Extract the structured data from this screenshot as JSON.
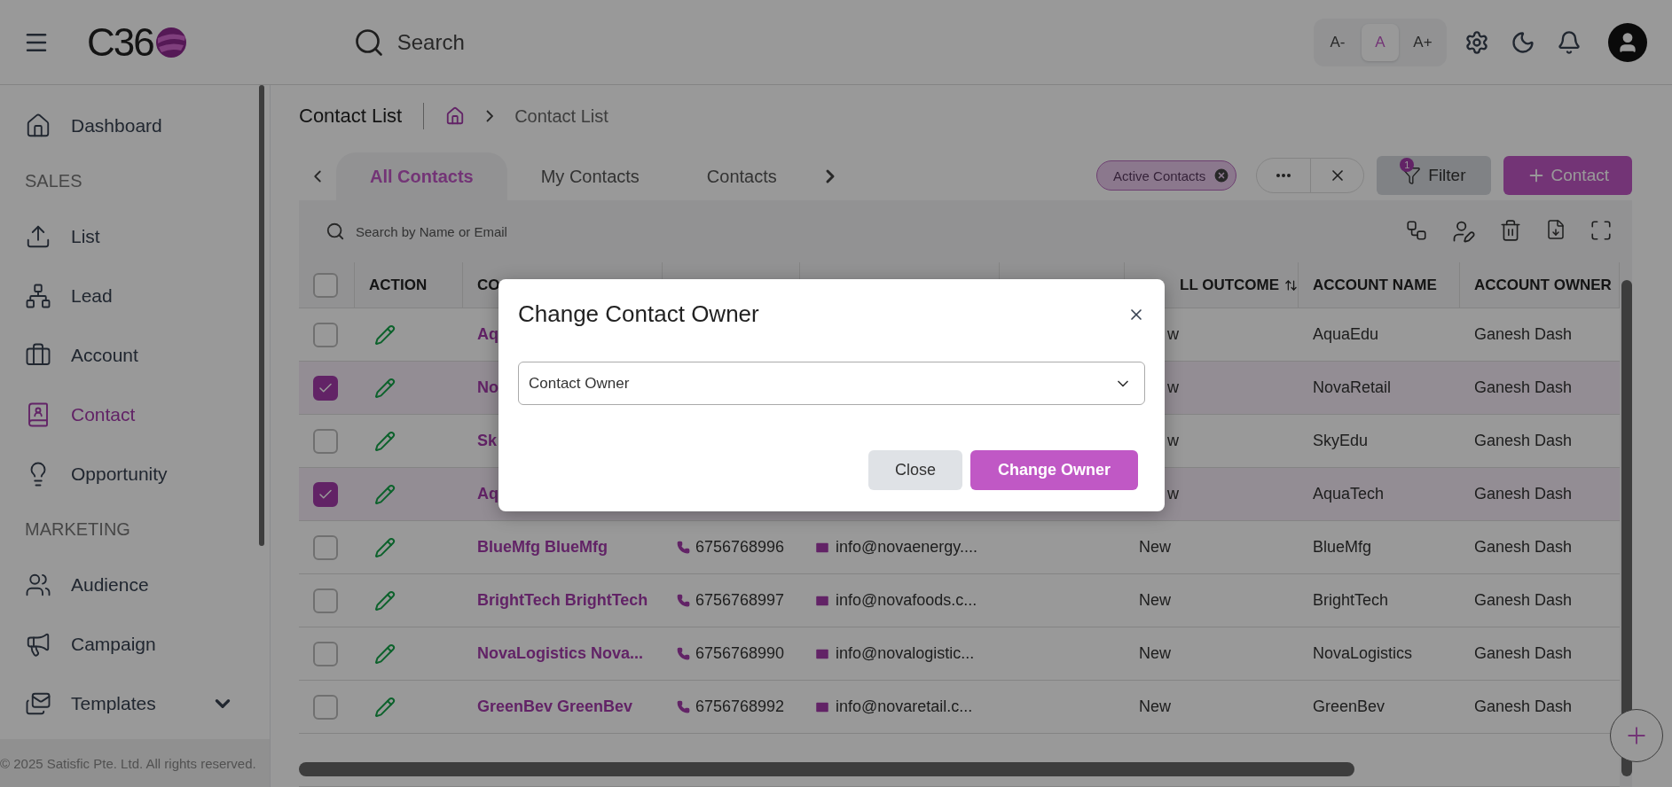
{
  "top_bar": {
    "logo": "C36",
    "search": {
      "placeholder": "Search"
    },
    "font_sizes": [
      {
        "label": "A-",
        "selected": false
      },
      {
        "label": "A",
        "selected": true
      },
      {
        "label": "A+",
        "selected": false
      }
    ]
  },
  "sidebar": {
    "items": [
      {
        "kind": "link",
        "label": "Dashboard",
        "selected": false
      },
      {
        "kind": "section",
        "label": "SALES"
      },
      {
        "kind": "link",
        "label": "List",
        "selected": false
      },
      {
        "kind": "link",
        "label": "Lead",
        "selected": false
      },
      {
        "kind": "link",
        "label": "Account",
        "selected": false
      },
      {
        "kind": "link",
        "label": "Contact",
        "selected": true
      },
      {
        "kind": "link",
        "label": "Opportunity",
        "selected": false
      },
      {
        "kind": "section",
        "label": "MARKETING"
      },
      {
        "kind": "link",
        "label": "Audience",
        "selected": false
      },
      {
        "kind": "link",
        "label": "Campaign",
        "selected": false
      },
      {
        "kind": "group",
        "label": "Templates",
        "selected": false,
        "expanded": false
      }
    ],
    "footer": "© 2025 Satisfic Pte. Ltd. All rights reserved."
  },
  "page": {
    "title": "Contact List",
    "breadcrumb": [
      "Contact List"
    ]
  },
  "tabs": [
    {
      "label": "All Contacts",
      "selected": true
    },
    {
      "label": "My Contacts",
      "selected": false
    },
    {
      "label": "Contacts",
      "selected": false
    }
  ],
  "chips": [
    {
      "label": "Active Contacts"
    }
  ],
  "filter": {
    "label": "Filter",
    "badge": "1"
  },
  "add_button": {
    "label": "Contact"
  },
  "table": {
    "search": {
      "placeholder": "Search by Name or Email"
    },
    "header_checked": false,
    "columns": [
      {
        "label": "ACTION"
      },
      {
        "label": "CO"
      },
      {},
      {},
      {},
      {
        "label": "LL OUTCOME",
        "covered": true,
        "sortable": true
      },
      {
        "label": "ACCOUNT NAME"
      },
      {
        "label": "ACCOUNT OWNER"
      }
    ],
    "rows": [
      {
        "checked": false,
        "covered": true,
        "contact": "Aq",
        "outcome": "w",
        "account": "AquaEdu",
        "owner": "Ganesh Dash"
      },
      {
        "checked": true,
        "covered": true,
        "contact": "No",
        "outcome": "w",
        "account": "NovaRetail",
        "owner": "Ganesh Dash"
      },
      {
        "checked": false,
        "covered": true,
        "contact": "Sk",
        "outcome": "w",
        "account": "SkyEdu",
        "owner": "Ganesh Dash"
      },
      {
        "checked": true,
        "covered": true,
        "contact": "Aq",
        "outcome": "w",
        "account": "AquaTech",
        "owner": "Ganesh Dash"
      },
      {
        "checked": false,
        "covered": false,
        "contact": "BlueMfg BlueMfg",
        "phone": "6756768996",
        "email": "info@novaenergy....",
        "outcome": "New",
        "account": "BlueMfg",
        "owner": "Ganesh Dash"
      },
      {
        "checked": false,
        "covered": false,
        "contact": "BrightTech BrightTech",
        "phone": "6756768997",
        "email": "info@novafoods.c...",
        "outcome": "New",
        "account": "BrightTech",
        "owner": "Ganesh Dash"
      },
      {
        "checked": false,
        "covered": false,
        "contact": "NovaLogistics Nova...",
        "phone": "6756768990",
        "email": "info@novalogistic...",
        "outcome": "New",
        "account": "NovaLogistics",
        "owner": "Ganesh Dash"
      },
      {
        "checked": false,
        "covered": false,
        "contact": "GreenBev GreenBev",
        "phone": "6756768992",
        "email": "info@novaretail.c...",
        "outcome": "New",
        "account": "GreenBev",
        "owner": "Ganesh Dash"
      }
    ]
  },
  "modal": {
    "title": "Change Contact Owner",
    "select": {
      "placeholder": "Contact Owner"
    },
    "buttons": [
      {
        "label": "Close",
        "kind": "secondary"
      },
      {
        "label": "Change Owner",
        "kind": "primary"
      }
    ]
  }
}
